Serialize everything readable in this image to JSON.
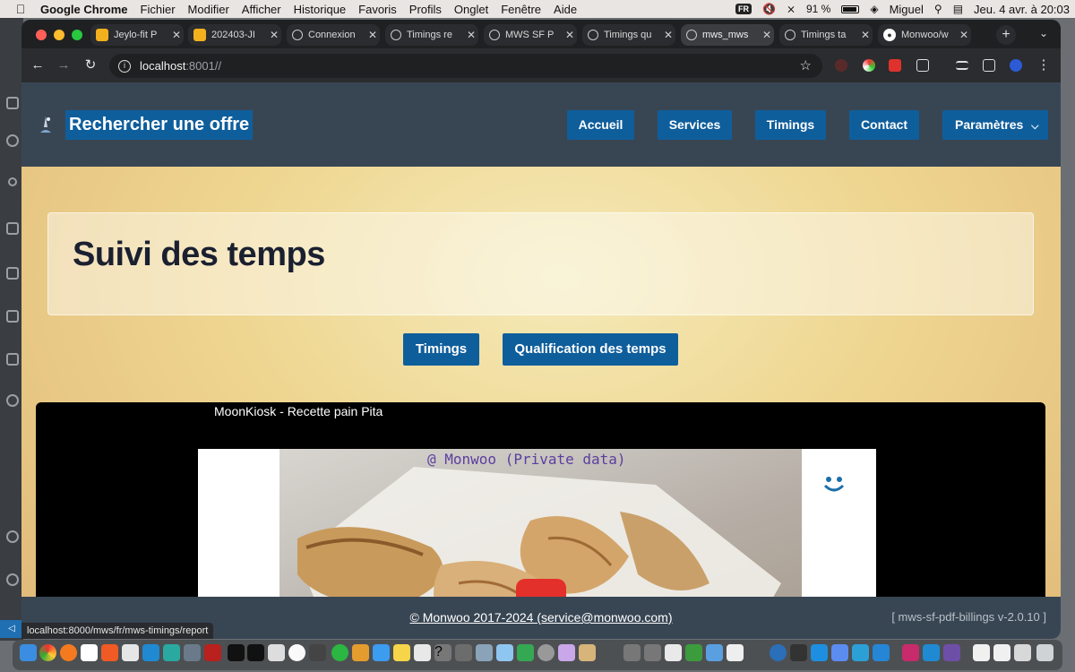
{
  "menubar": {
    "app": "Google Chrome",
    "items": [
      "Fichier",
      "Modifier",
      "Afficher",
      "Historique",
      "Favoris",
      "Profils",
      "Onglet",
      "Fenêtre",
      "Aide"
    ],
    "input_source": "FR",
    "battery": "91 %",
    "user": "Miguel",
    "datetime": "Jeu. 4 avr. à 20:03"
  },
  "tabs": [
    {
      "title": "Jeylo-fit P",
      "fav_color": "#f2b01e",
      "fav_type": "slides"
    },
    {
      "title": "202403-JI",
      "fav_color": "#f2b01e",
      "fav_type": "slides"
    },
    {
      "title": "Connexion",
      "fav_color": "#c9c9c9",
      "fav_type": "globe"
    },
    {
      "title": "Timings re",
      "fav_color": "#c9c9c9",
      "fav_type": "globe"
    },
    {
      "title": "MWS SF P",
      "fav_color": "#c9c9c9",
      "fav_type": "globe"
    },
    {
      "title": "Timings qu",
      "fav_color": "#c9c9c9",
      "fav_type": "globe"
    },
    {
      "title": "mws_mws",
      "fav_color": "#c9c9c9",
      "fav_type": "globe",
      "active": true
    },
    {
      "title": "Timings ta",
      "fav_color": "#c9c9c9",
      "fav_type": "globe"
    },
    {
      "title": "Monwoo/w",
      "fav_color": "#ffffff",
      "fav_type": "github"
    }
  ],
  "address": {
    "host": "localhost",
    "path": ":8001//"
  },
  "site": {
    "brand": "Rechercher une offre",
    "nav": [
      "Accueil",
      "Services",
      "Timings",
      "Contact"
    ],
    "settings": "Paramètres",
    "page_title": "Suivi des temps",
    "actions": [
      "Timings",
      "Qualification des temps"
    ],
    "video_title": "MoonKiosk - Recette pain Pita",
    "watermark": "@ Monwoo (Private data)",
    "footer_copyright": "© Monwoo 2017-2024 (service@monwoo.com)",
    "footer_version": "[ mws-sf-pdf-billings v-2.0.10 ]"
  },
  "status_url": "localhost:8000/mws/fr/mws-timings/report",
  "colors": {
    "nav_bg": "#384654",
    "button_bg": "#0f5e9c",
    "title_text": "#1a2030",
    "page_gradient_center": "#f5eab8",
    "page_gradient_edge": "#e0b878"
  }
}
